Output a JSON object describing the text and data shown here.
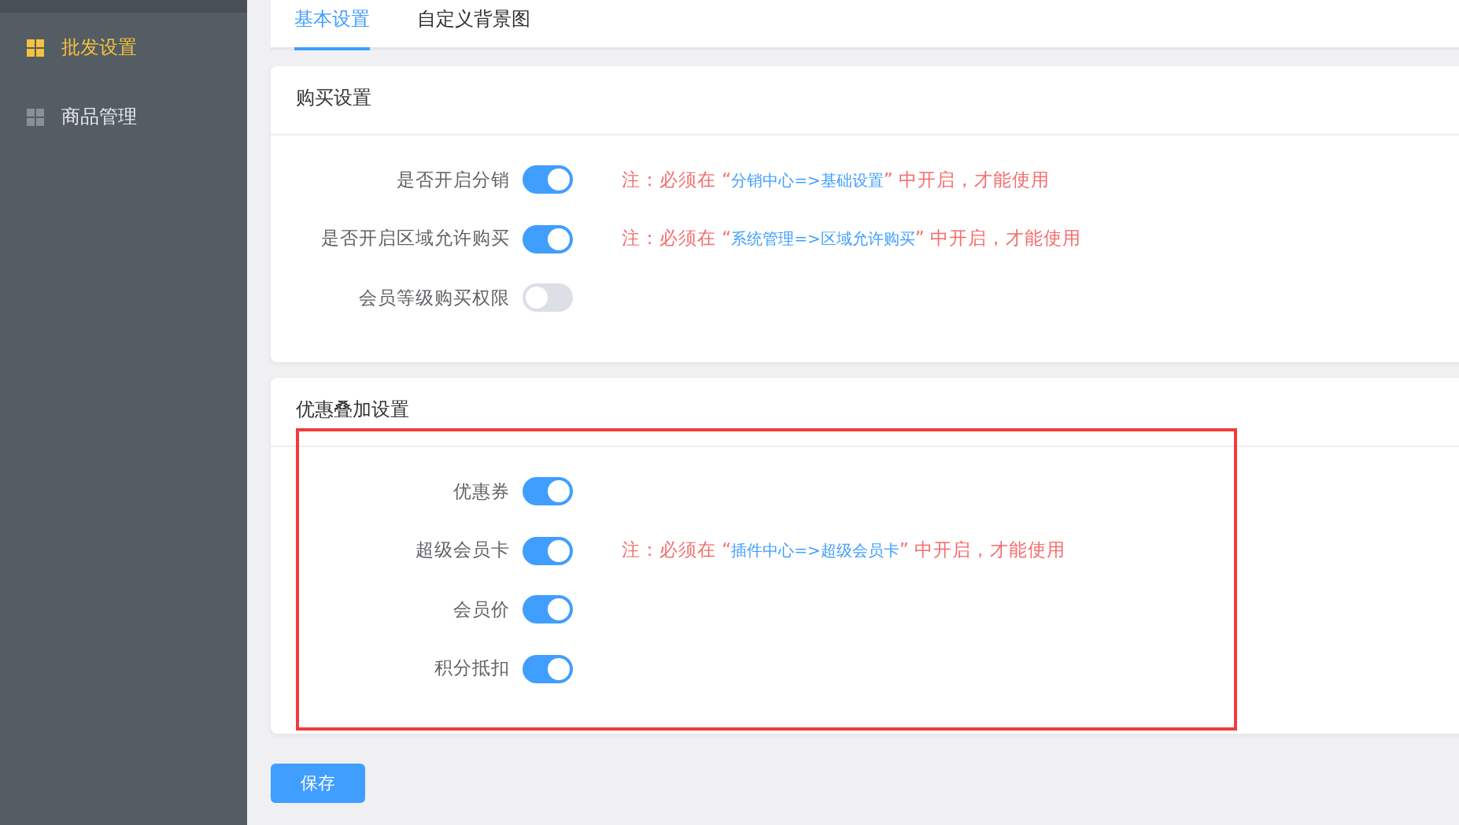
{
  "sidebar": {
    "items": [
      {
        "label": "批发设置",
        "selected": true
      },
      {
        "label": "商品管理",
        "selected": false
      }
    ]
  },
  "tabs": [
    {
      "label": "基本设置",
      "selected": true
    },
    {
      "label": "自定义背景图",
      "selected": false
    }
  ],
  "sections": [
    {
      "title": "购买设置",
      "rows": [
        {
          "label": "是否开启分销",
          "on": true,
          "note": {
            "prefix": "注：必须在 “",
            "path": "分销中心=>基础设置",
            "suffix": "” 中开启，才能使用"
          }
        },
        {
          "label": "是否开启区域允许购买",
          "on": true,
          "note": {
            "prefix": "注：必须在 “",
            "path": "系统管理=>区域允许购买",
            "suffix": "” 中开启，才能使用"
          }
        },
        {
          "label": "会员等级购买权限",
          "on": false
        }
      ]
    },
    {
      "title": "优惠叠加设置",
      "highlighted": true,
      "rows": [
        {
          "label": "优惠券",
          "on": true
        },
        {
          "label": "超级会员卡",
          "on": true,
          "note": {
            "prefix": "注：必须在 “",
            "path": "插件中心=>超级会员卡",
            "suffix": "” 中开启，才能使用"
          }
        },
        {
          "label": "会员价",
          "on": true
        },
        {
          "label": "积分抵扣",
          "on": true
        }
      ]
    }
  ],
  "save_button": "保存"
}
